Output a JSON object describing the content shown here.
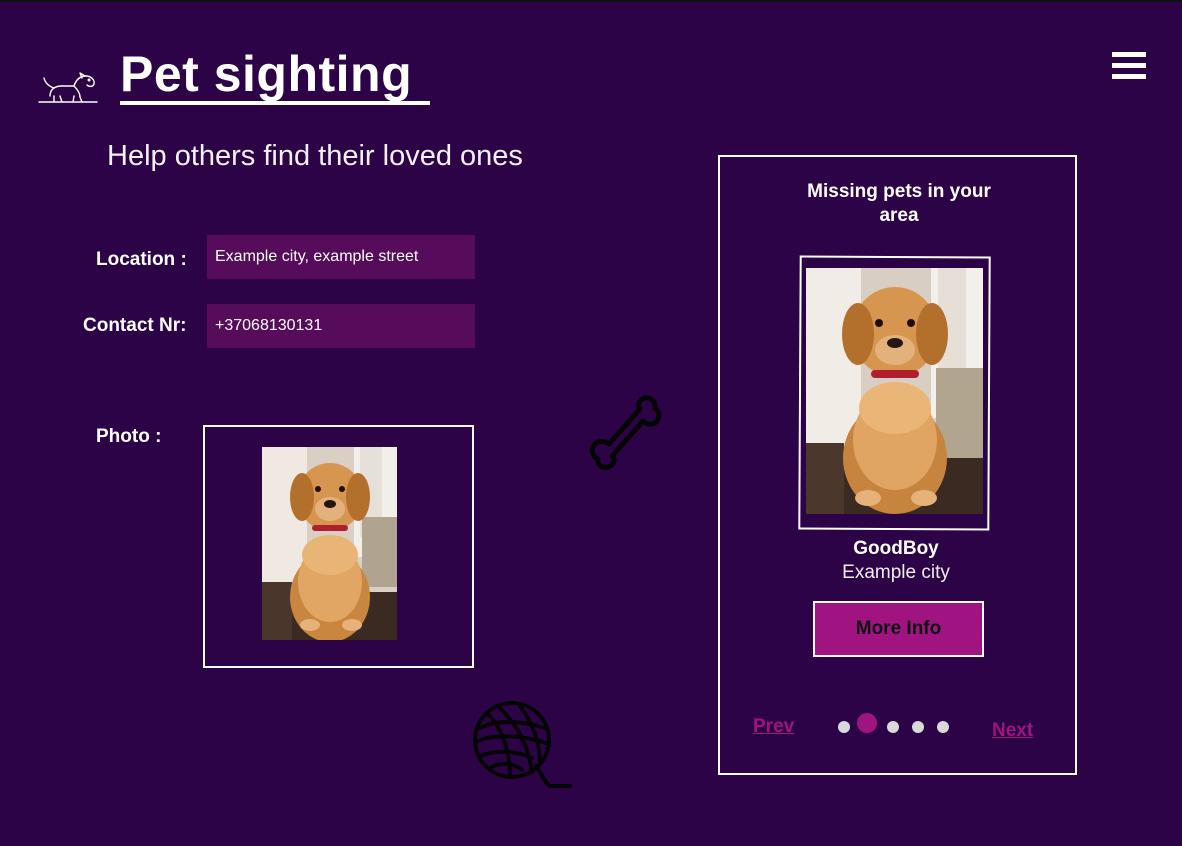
{
  "header": {
    "title": "Pet sighting",
    "subtitle": "Help others find their loved ones",
    "logo_icon": "dog-icon",
    "menu_icon": "hamburger-menu-icon"
  },
  "form": {
    "location_label": "Location :",
    "location_value": "Example city, example street",
    "contact_label": "Contact Nr:",
    "contact_value": "+37068130131",
    "photo_label": "Photo :"
  },
  "decorations": {
    "bone_icon": "bone-icon",
    "yarn_icon": "yarn-ball-icon"
  },
  "missing_card": {
    "title": "Missing pets in your area",
    "pet_name": "GoodBoy",
    "pet_city": "Example city",
    "more_info_label": "More Info",
    "prev_label": "Prev",
    "next_label": "Next",
    "page_count": 5,
    "active_page": 2
  },
  "colors": {
    "background": "#2c0347",
    "input_background": "#560c5a",
    "accent": "#a01481",
    "text": "#ffffff"
  }
}
